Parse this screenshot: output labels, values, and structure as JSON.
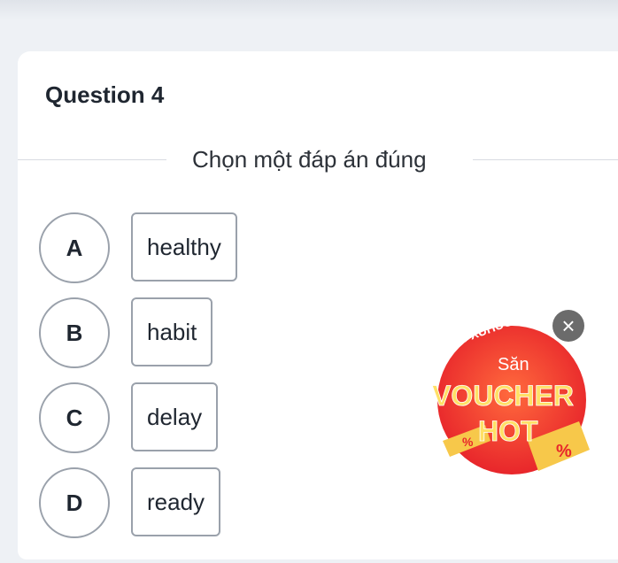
{
  "question": {
    "title": "Question 4",
    "instruction": "Chọn một đáp án đúng"
  },
  "options": [
    {
      "letter": "A",
      "text": "healthy"
    },
    {
      "letter": "B",
      "text": "habit"
    },
    {
      "letter": "C",
      "text": "delay"
    },
    {
      "letter": "D",
      "text": "ready"
    }
  ],
  "promo": {
    "hashtag": "#SHOPXUHUONG",
    "line1": "Săn",
    "line2": "VOUCHER",
    "line3": "HOT",
    "close_icon": "×",
    "colors": {
      "badge_red": "#ef3b2c",
      "badge_orange": "#ff8a3d",
      "text_yellow": "#ffe066",
      "ticket_yellow": "#f7c84a"
    }
  }
}
